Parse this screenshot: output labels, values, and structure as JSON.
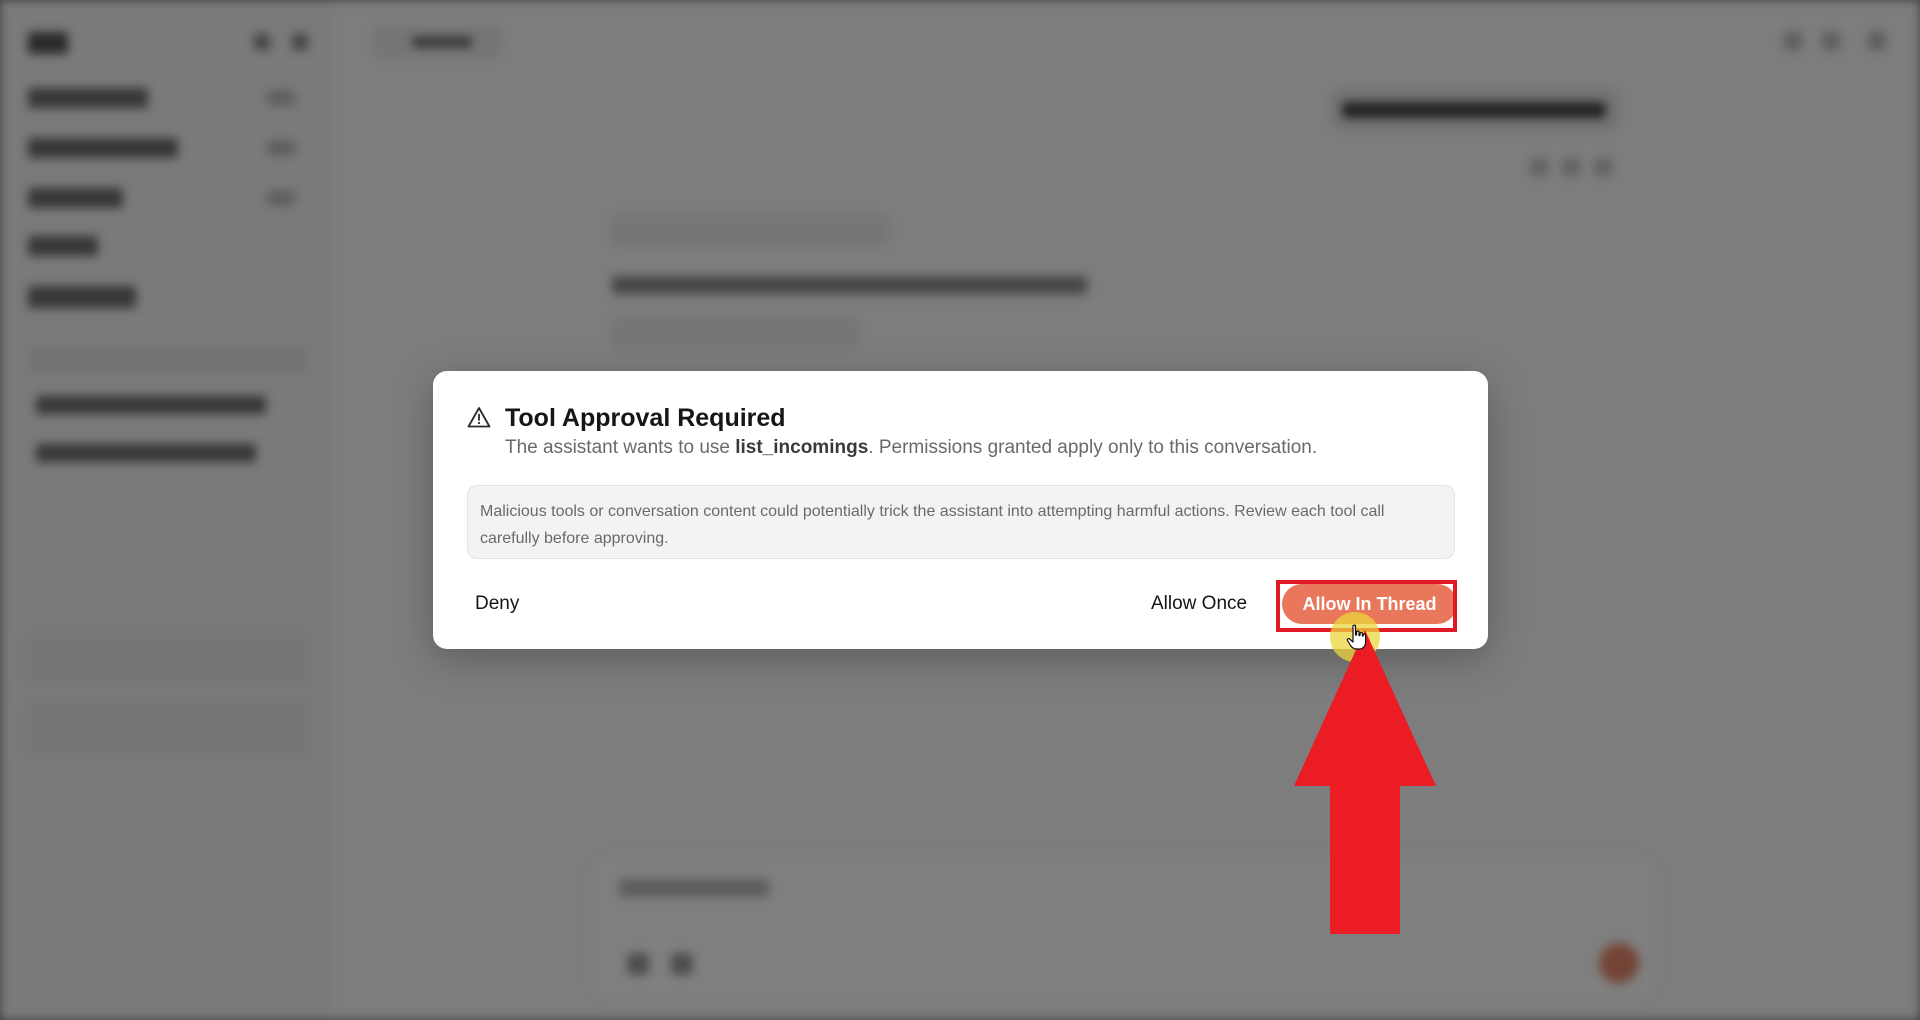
{
  "dialog": {
    "title": "Tool Approval Required",
    "desc_prefix": "The assistant wants to use ",
    "tool_name": "list_incomings",
    "desc_suffix": ". Permissions granted apply only to this conversation.",
    "warning_text": "Malicious tools or conversation content could potentially trick the assistant into attempting harmful actions. Review each tool call carefully before approving.",
    "deny_label": "Deny",
    "allow_once_label": "Allow Once",
    "allow_thread_label": "Allow In Thread",
    "primary_color": "#e8775c"
  },
  "annotation": {
    "highlight_color": "#e01a24",
    "arrow_color": "#ec1c24",
    "cursor_halo_color": "#ecd63c"
  },
  "icons": {
    "warning": "warning-triangle-icon",
    "cursor": "hand-pointer-icon"
  }
}
